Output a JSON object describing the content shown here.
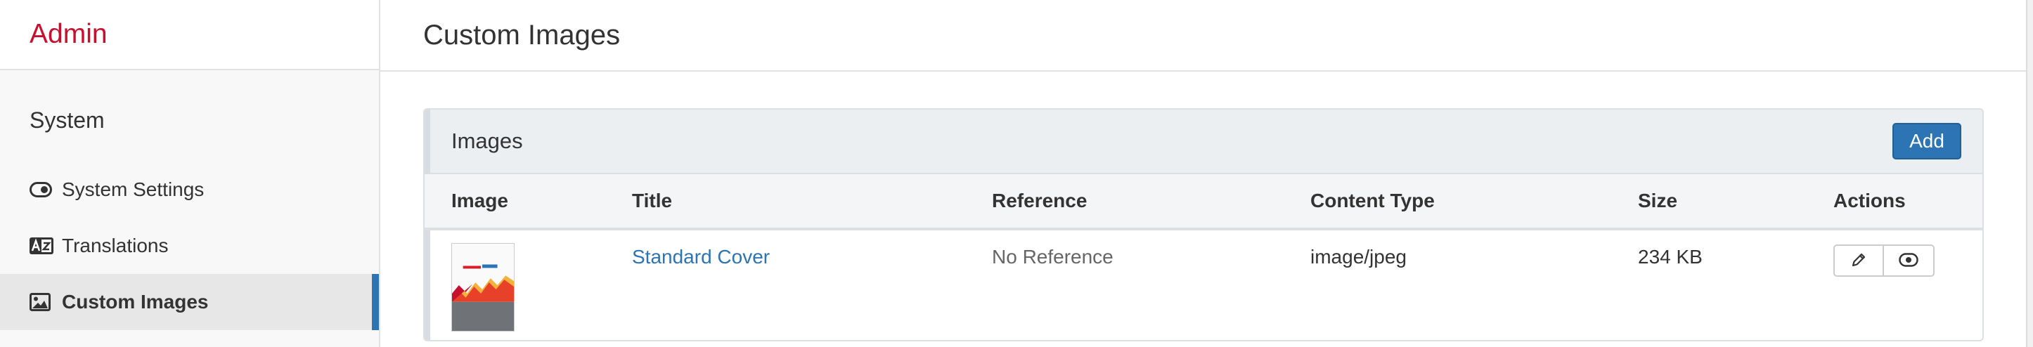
{
  "sidebar": {
    "brand": "Admin",
    "section_title": "System",
    "items": [
      {
        "label": "System Settings",
        "icon": "toggle-icon"
      },
      {
        "label": "Translations",
        "icon": "translate-icon"
      },
      {
        "label": "Custom Images",
        "icon": "image-icon",
        "active": true
      }
    ]
  },
  "page": {
    "title": "Custom Images"
  },
  "panel": {
    "title": "Images",
    "add_label": "Add",
    "columns": [
      "Image",
      "Title",
      "Reference",
      "Content Type",
      "Size",
      "Actions"
    ],
    "rows": [
      {
        "title": "Standard Cover",
        "reference": "No Reference",
        "content_type": "image/jpeg",
        "size": "234 KB",
        "actions": [
          "edit-icon",
          "view-icon"
        ]
      }
    ]
  },
  "colors": {
    "brand": "#c8102e",
    "accent": "#2c74b3"
  }
}
